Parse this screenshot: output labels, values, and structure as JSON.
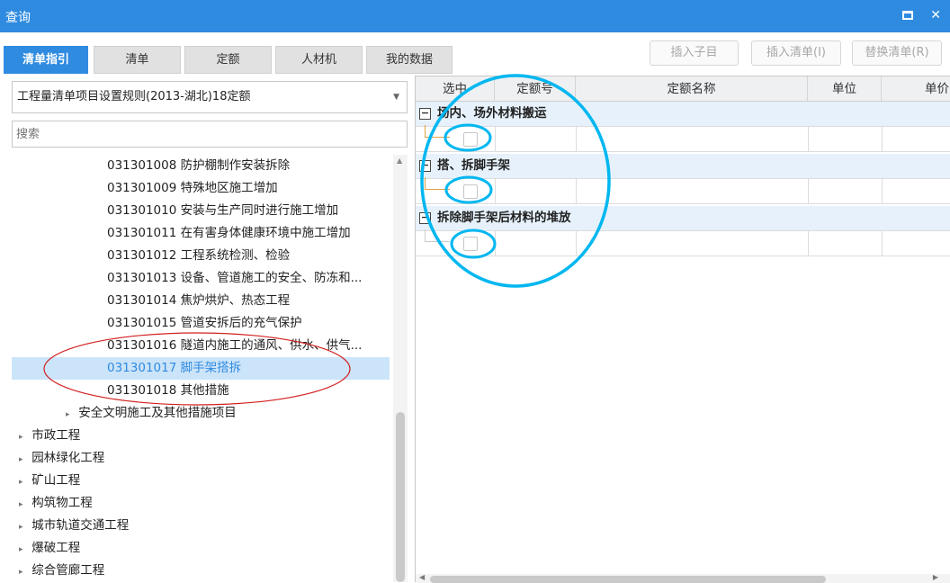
{
  "window": {
    "title": "查询",
    "maximize_icon": "maximize-icon",
    "close_label": "✕"
  },
  "tabs": [
    {
      "label": "清单指引",
      "active": true
    },
    {
      "label": "清单",
      "active": false
    },
    {
      "label": "定额",
      "active": false
    },
    {
      "label": "人材机",
      "active": false
    },
    {
      "label": "我的数据",
      "active": false
    }
  ],
  "toolbar": {
    "insert_child": "插入子目",
    "insert_list": "插入清单(I)",
    "replace_list": "替换清单(R)"
  },
  "left": {
    "standard_select": "工程量清单项目设置规则(2013-湖北)18定额",
    "search_placeholder": "搜索",
    "tree": [
      {
        "text": "031301008  防护棚制作安装拆除",
        "indent": 2
      },
      {
        "text": "031301009  特殊地区施工增加",
        "indent": 2
      },
      {
        "text": "031301010  安装与生产同时进行施工增加",
        "indent": 2
      },
      {
        "text": "031301011  在有害身体健康环境中施工增加",
        "indent": 2
      },
      {
        "text": "031301012  工程系统检测、检验",
        "indent": 2
      },
      {
        "text": "031301013  设备、管道施工的安全、防冻和...",
        "indent": 2
      },
      {
        "text": "031301014  焦炉烘炉、热态工程",
        "indent": 2
      },
      {
        "text": "031301015  管道安拆后的充气保护",
        "indent": 2
      },
      {
        "text": "031301016  隧道内施工的通风、供水、供气...",
        "indent": 2
      },
      {
        "text": "031301017  脚手架搭拆",
        "indent": 2,
        "selected": true
      },
      {
        "text": "031301018  其他措施",
        "indent": 2
      },
      {
        "text": "安全文明施工及其他措施项目",
        "indent": 1,
        "caret": "▸"
      },
      {
        "text": "市政工程",
        "indent": 0,
        "caret": "▸"
      },
      {
        "text": "园林绿化工程",
        "indent": 0,
        "caret": "▸"
      },
      {
        "text": "矿山工程",
        "indent": 0,
        "caret": "▸"
      },
      {
        "text": "构筑物工程",
        "indent": 0,
        "caret": "▸"
      },
      {
        "text": "城市轨道交通工程",
        "indent": 0,
        "caret": "▸"
      },
      {
        "text": "爆破工程",
        "indent": 0,
        "caret": "▸"
      },
      {
        "text": "综合管廊工程",
        "indent": 0,
        "caret": "▸"
      }
    ]
  },
  "grid": {
    "columns": [
      "选中",
      "定额号",
      "定额名称",
      "单位",
      "单价"
    ],
    "groups": [
      {
        "label": "场内、场外材料搬运",
        "collapse_symbol": "−"
      },
      {
        "label": "搭、拆脚手架",
        "collapse_symbol": "−"
      },
      {
        "label": "拆除脚手架后材料的堆放",
        "collapse_symbol": "−"
      }
    ]
  },
  "annotations": {
    "highlight_color": "#00b7f0",
    "ellipse_color": "#d22020"
  },
  "colors": {
    "accent": "#2f8be0",
    "selected_row": "#cce4f9",
    "group_row": "#e6f1fb"
  }
}
